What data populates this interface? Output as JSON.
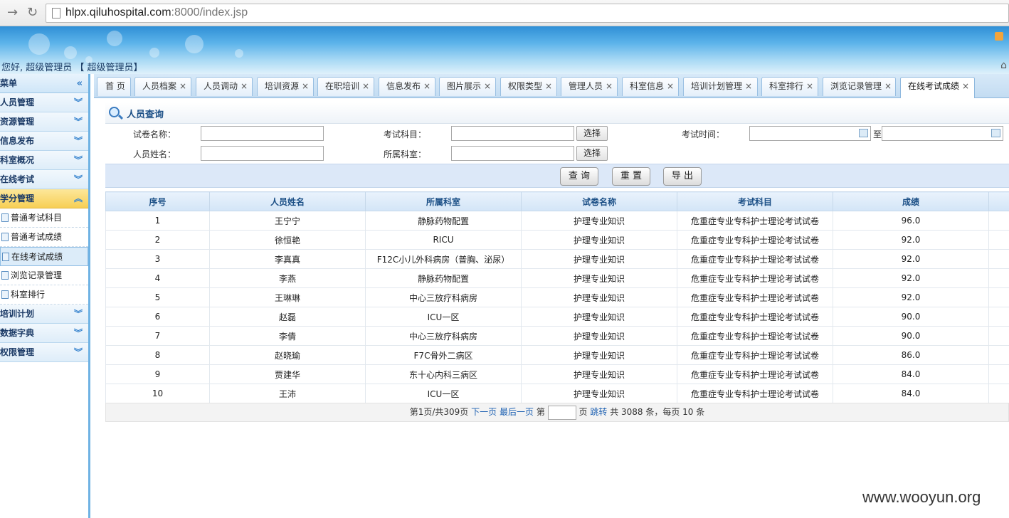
{
  "browser": {
    "url_host": "hlpx.qiluhospital.com",
    "url_rest": ":8000/index.jsp"
  },
  "header": {
    "greeting": "您好, 超级管理员 【 超级管理员】"
  },
  "sidebar": {
    "title": "菜单",
    "groups": [
      {
        "label": "人员管理"
      },
      {
        "label": "资源管理"
      },
      {
        "label": "信息发布"
      },
      {
        "label": "科室概况"
      },
      {
        "label": "在线考试"
      },
      {
        "label": "学分管理"
      }
    ],
    "sub_items": [
      {
        "label": "普通考试科目"
      },
      {
        "label": "普通考试成绩"
      },
      {
        "label": "在线考试成绩"
      },
      {
        "label": "浏览记录管理"
      },
      {
        "label": "科室排行"
      }
    ],
    "groups_after": [
      {
        "label": "培训计划"
      },
      {
        "label": "数据字典"
      },
      {
        "label": "权限管理"
      }
    ]
  },
  "tabs": [
    {
      "label": "首 页"
    },
    {
      "label": "人员档案"
    },
    {
      "label": "人员调动"
    },
    {
      "label": "培训资源"
    },
    {
      "label": "在职培训"
    },
    {
      "label": "信息发布"
    },
    {
      "label": "图片展示"
    },
    {
      "label": "权限类型"
    },
    {
      "label": "管理人员"
    },
    {
      "label": "科室信息"
    },
    {
      "label": "培训计划管理"
    },
    {
      "label": "科室排行"
    },
    {
      "label": "浏览记录管理"
    },
    {
      "label": "在线考试成绩"
    }
  ],
  "tab_close": "×",
  "panel": {
    "title": "人员查询"
  },
  "form": {
    "paper_name_label": "试卷名称：",
    "subject_label": "考试科目：",
    "exam_time_label": "考试时间：",
    "to_label": "至",
    "person_name_label": "人员姓名：",
    "dept_label": "所属科室：",
    "select_label": "选择"
  },
  "actions": {
    "query": "查 询",
    "reset": "重 置",
    "export": "导 出"
  },
  "table": {
    "columns": [
      "序号",
      "人员姓名",
      "所属科室",
      "试卷名称",
      "考试科目",
      "成绩"
    ],
    "rows": [
      [
        "1",
        "王宁宁",
        "静脉药物配置",
        "护理专业知识",
        "危重症专业专科护士理论考试试卷",
        "96.0"
      ],
      [
        "2",
        "徐恒艳",
        "RICU",
        "护理专业知识",
        "危重症专业专科护士理论考试试卷",
        "92.0"
      ],
      [
        "3",
        "李真真",
        "F12C小儿外科病房（普胸、泌尿）",
        "护理专业知识",
        "危重症专业专科护士理论考试试卷",
        "92.0"
      ],
      [
        "4",
        "李燕",
        "静脉药物配置",
        "护理专业知识",
        "危重症专业专科护士理论考试试卷",
        "92.0"
      ],
      [
        "5",
        "王琳琳",
        "中心三放疗科病房",
        "护理专业知识",
        "危重症专业专科护士理论考试试卷",
        "92.0"
      ],
      [
        "6",
        "赵磊",
        "ICU一区",
        "护理专业知识",
        "危重症专业专科护士理论考试试卷",
        "90.0"
      ],
      [
        "7",
        "李倩",
        "中心三放疗科病房",
        "护理专业知识",
        "危重症专业专科护士理论考试试卷",
        "90.0"
      ],
      [
        "8",
        "赵晓瑜",
        "F7C骨外二病区",
        "护理专业知识",
        "危重症专业专科护士理论考试试卷",
        "86.0"
      ],
      [
        "9",
        "贾建华",
        "东十心内科三病区",
        "护理专业知识",
        "危重症专业专科护士理论考试试卷",
        "84.0"
      ],
      [
        "10",
        "王沛",
        "ICU一区",
        "护理专业知识",
        "危重症专业专科护士理论考试试卷",
        "84.0"
      ]
    ]
  },
  "pager": {
    "info": "第1页/共309页",
    "next": "下一页",
    "last": "最后一页",
    "page_prefix": "第",
    "page_suffix": "页",
    "jump": "跳转",
    "summary": "共 3088 条，每页 10 条"
  },
  "watermark": "www.wooyun.org"
}
